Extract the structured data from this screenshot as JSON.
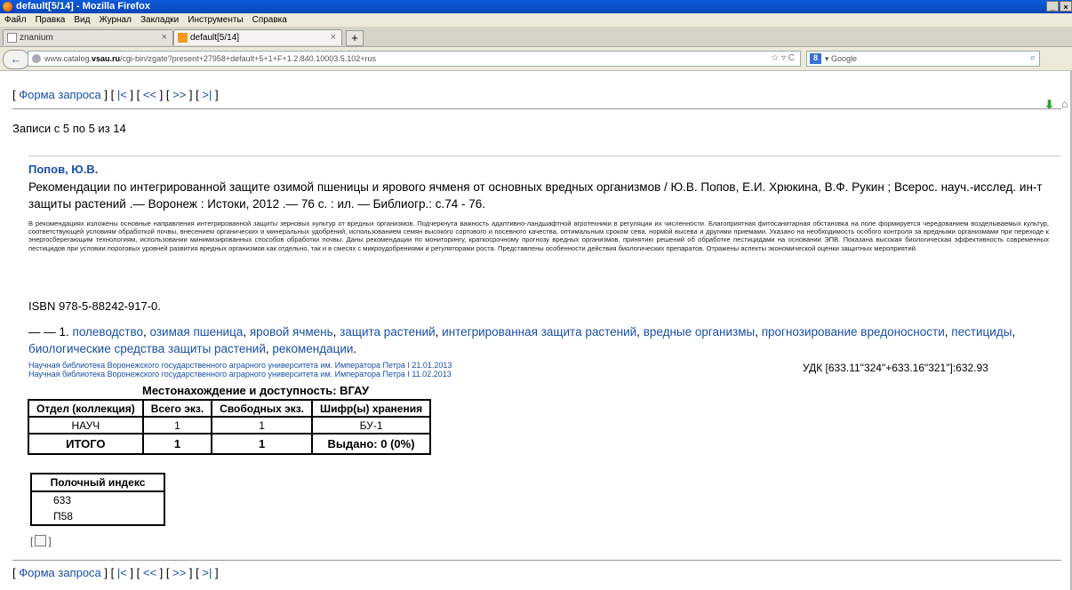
{
  "window": {
    "title": "default[5/14] - Mozilla Firefox",
    "buttons": [
      "_",
      "×"
    ]
  },
  "menu": [
    "Файл",
    "Правка",
    "Вид",
    "Журнал",
    "Закладки",
    "Инструменты",
    "Справка"
  ],
  "tabs": [
    {
      "label": "znanium",
      "active": false,
      "close": "×"
    },
    {
      "label": "default[5/14]",
      "active": true,
      "close": "×"
    }
  ],
  "newtab_label": "+",
  "nav": {
    "back": "←",
    "url_prefix": "www.catalog.",
    "url_host": "vsau.ru",
    "url_rest": "/cgi-bin/zgate?present+27958+default+5+1+F+1.2.840.10003.5.102+rus",
    "url_icons": "☆ ▿ C",
    "search_engine_icon": "8",
    "search_placeholder": "▾ Google",
    "search_button": "⌕",
    "download_icon": "⬇",
    "home_icon": "⌂"
  },
  "query_nav": {
    "open1": "[ ",
    "form_link": "Форма запроса",
    "mid1": " ] [ ",
    "first": "|<",
    "mid2": " ] [ ",
    "prev": "<<",
    "mid3": " ] [ ",
    "next": ">>",
    "mid4": " ] [ ",
    "last": ">|",
    "close": " ]"
  },
  "records_text": "Записи с 5 по 5 из 14",
  "record": {
    "author": "Попов, Ю.В.",
    "title": "Рекомендации по интегрированной защите озимой пшеницы и ярового ячменя от основных вредных организмов / Ю.В. Попов, Е.И. Хрюкина, В.Ф. Рукин ; Всерос. науч.-исслед. ин-т защиты растений .— Воронеж : Истоки, 2012 .— 76 с. : ил. — Библиогр.: с.74 - 76.",
    "abstract": "В рекомендациях изложены основные направления интегрированной защиты зерновых культур от вредных организмов. Подчеркнута важность адаптивно-ландшафтной агротехники в регуляции их численности. Благоприятная фитосанитарная обстановка на поле формируется чередованием возделываемых культур, соответствующей условиям обработкой почвы, внесением органических и минеральных удобрений, использованием семян высокого сортового и посевного качества, оптимальным сроком сева, нормой высева и другими приемами. Указано на необходимость особого контроля за вредными организмами при переходе к энергосберегающим технологиям, использовании минимизированных способов обработки почвы. Даны рекомендации по мониторингу, краткосрочному прогнозу вредных организмов, принятию решений об обработке пестицидами на основании ЭПВ. Показана высокая биологическая эффективность современных пестицидов при условии пороговых уровней развития вредных организмов как отдельно, так и в смесях с микроудобрениями и регуляторами роста. Представлены особенности действия биологических препаратов. Отражены аспекты экономической оценки защитных мероприятий.",
    "isbn": "ISBN 978-5-88242-917-0.",
    "subjects_prefix": "— — 1. ",
    "subjects": [
      "полеводство",
      "озимая пшеница",
      "яровой ячмень",
      "защита растений",
      "интегрированная защита растений",
      "вредные организмы",
      "прогнозирование вредоносности",
      "пестициды",
      "биологические средства защиты растений",
      "рекомендации"
    ],
    "subjects_suffix": ".",
    "sources": [
      "Научная библиотека Воронежского государственного аграрного университета им. Императора Петра I 21.01.2013",
      "Научная библиотека Воронежского государственного аграрного университета им. Императора Петра I 11.02.2013"
    ],
    "udk": "УДК [633.11\"324\"+633.16\"321\"]:632.93"
  },
  "location": {
    "title": "Местонахождение и доступность: ВГАУ",
    "headers": [
      "Отдел (коллекция)",
      "Всего экз.",
      "Свободных экз.",
      "Шифр(ы) хранения"
    ],
    "rows": [
      [
        "НАУЧ",
        "1",
        "1",
        "БУ-1"
      ]
    ],
    "total": [
      "ИТОГО",
      "1",
      "1",
      "Выдано: 0 (0%)"
    ]
  },
  "shelf": {
    "header": "Полочный индекс",
    "values": [
      "633",
      "П58"
    ]
  },
  "mark": {
    "open": "[",
    "close": "]"
  }
}
